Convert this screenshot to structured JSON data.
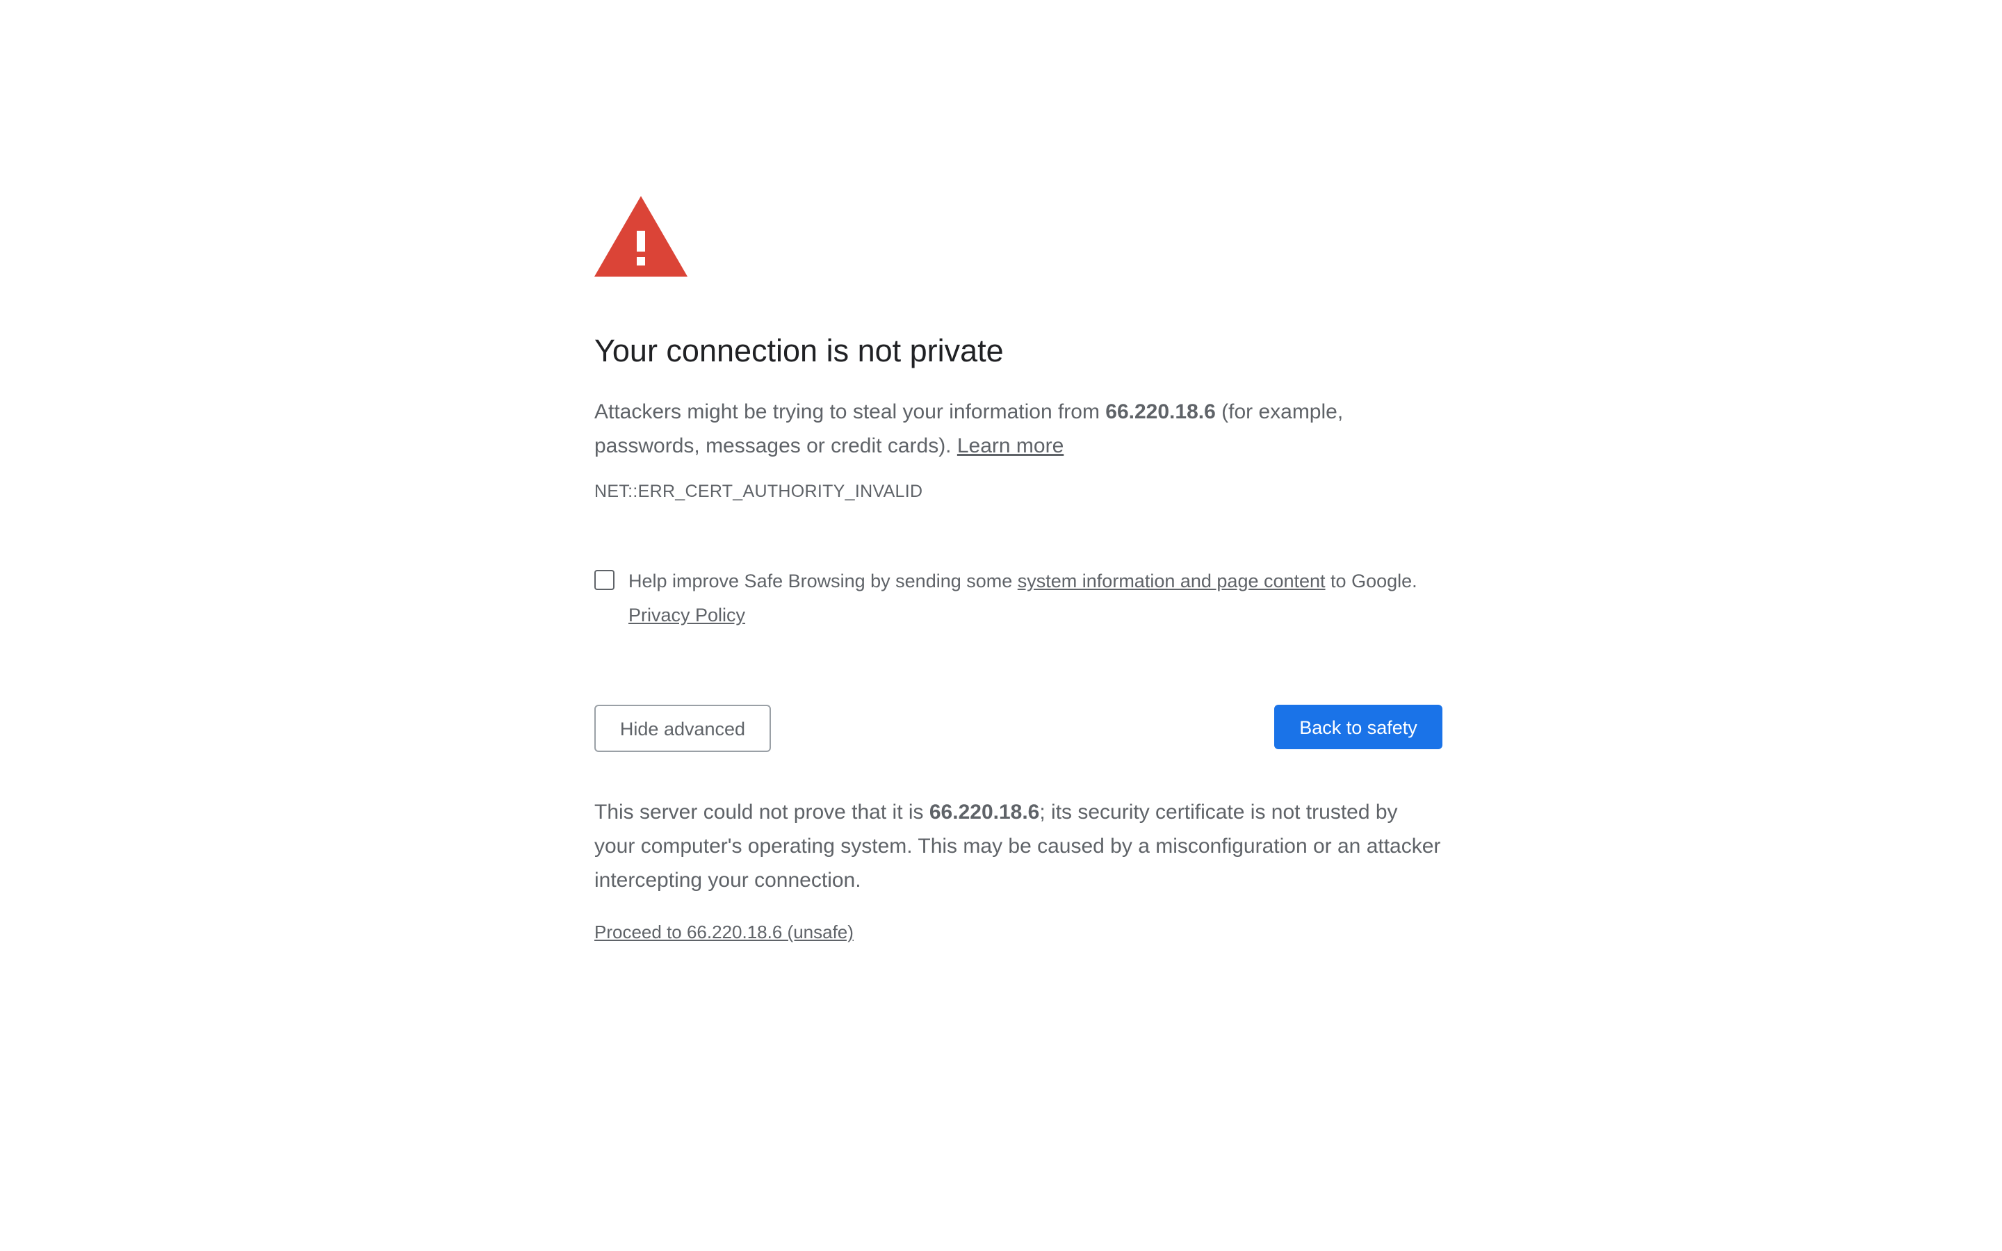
{
  "icon": {
    "name": "warning-triangle-icon",
    "color": "#db4437"
  },
  "heading": "Your connection is not private",
  "explanation": {
    "prefix": "Attackers might be trying to steal your information from ",
    "host": "66.220.18.6",
    "suffix": " (for example, passwords, messages or credit cards). ",
    "learn_more": "Learn more"
  },
  "error_code": "NET::ERR_CERT_AUTHORITY_INVALID",
  "safe_browsing": {
    "checked": false,
    "prefix": "Help improve Safe Browsing by sending some ",
    "link": "system information and page content",
    "suffix": " to Google. ",
    "privacy_link": "Privacy Policy"
  },
  "buttons": {
    "hide_advanced": "Hide advanced",
    "back_to_safety": "Back to safety"
  },
  "details": {
    "prefix": "This server could not prove that it is ",
    "host": "66.220.18.6",
    "suffix": "; its security certificate is not trusted by your computer's operating system. This may be caused by a misconfiguration or an attacker intercepting your connection."
  },
  "proceed_link": "Proceed to 66.220.18.6 (unsafe)",
  "colors": {
    "primary": "#1a73e8",
    "heading": "#202124",
    "text": "#5f6368",
    "warning": "#db4437"
  }
}
